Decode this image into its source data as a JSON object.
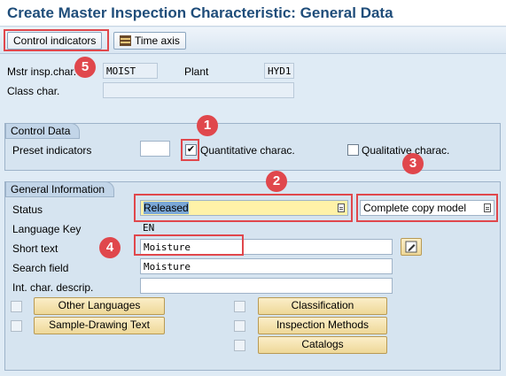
{
  "window": {
    "title": "Create Master Inspection Characteristic: General Data"
  },
  "toolbar": {
    "control_indicators_label": "Control indicators",
    "time_axis_label": "Time axis"
  },
  "header": {
    "mstr_insp_char_label": "Mstr insp.char.",
    "mstr_insp_char_value": "MOIST",
    "plant_label": "Plant",
    "plant_value": "HYD1",
    "class_char_label": "Class char.",
    "class_char_value": ""
  },
  "control_data": {
    "title": "Control Data",
    "preset_indicators_label": "Preset indicators",
    "preset_indicators_value": "",
    "quantitative_label": "Quantitative charac.",
    "quantitative_checked": true,
    "qualitative_label": "Qualitative charac.",
    "qualitative_checked": false
  },
  "general_information": {
    "title": "General Information",
    "status_label": "Status",
    "status_value": "Released",
    "copy_model_value": "Complete copy model",
    "language_key_label": "Language Key",
    "language_key_value": "EN",
    "short_text_label": "Short text",
    "short_text_value": "Moisture",
    "search_field_label": "Search field",
    "search_field_value": "Moisture",
    "int_char_descrip_label": "Int. char. descrip.",
    "int_char_descrip_value": "",
    "buttons": {
      "other_languages": "Other Languages",
      "sample_drawing_text": "Sample-Drawing Text",
      "classification": "Classification",
      "inspection_methods": "Inspection Methods",
      "catalogs": "Catalogs"
    }
  },
  "annotations": [
    "1",
    "2",
    "3",
    "4",
    "5"
  ],
  "colors": {
    "highlight": "#e0474c",
    "title": "#1f4d7a",
    "status_field": "#fff2a8"
  }
}
